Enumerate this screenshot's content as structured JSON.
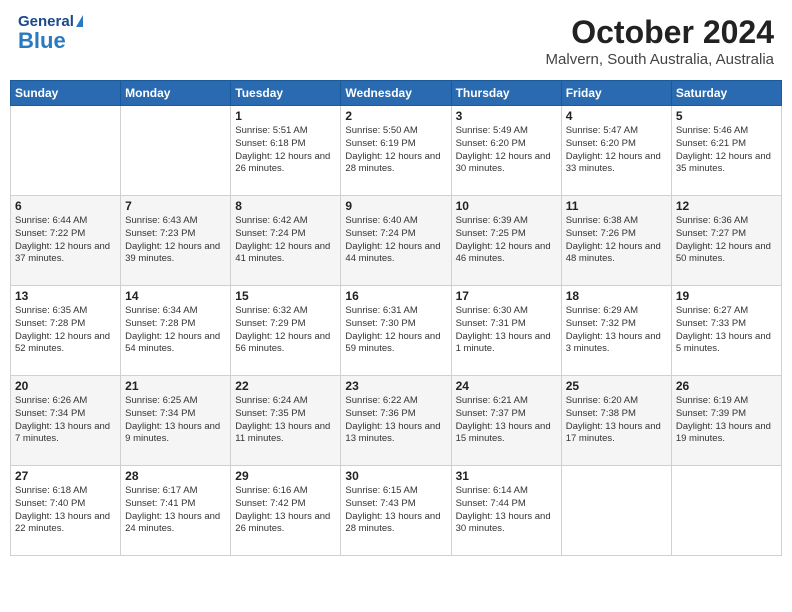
{
  "header": {
    "logo_general": "General",
    "logo_blue": "Blue",
    "title": "October 2024",
    "subtitle": "Malvern, South Australia, Australia"
  },
  "days_of_week": [
    "Sunday",
    "Monday",
    "Tuesday",
    "Wednesday",
    "Thursday",
    "Friday",
    "Saturday"
  ],
  "weeks": [
    [
      {
        "day": "",
        "sunrise": "",
        "sunset": "",
        "daylight": ""
      },
      {
        "day": "",
        "sunrise": "",
        "sunset": "",
        "daylight": ""
      },
      {
        "day": "1",
        "sunrise": "Sunrise: 5:51 AM",
        "sunset": "Sunset: 6:18 PM",
        "daylight": "Daylight: 12 hours and 26 minutes."
      },
      {
        "day": "2",
        "sunrise": "Sunrise: 5:50 AM",
        "sunset": "Sunset: 6:19 PM",
        "daylight": "Daylight: 12 hours and 28 minutes."
      },
      {
        "day": "3",
        "sunrise": "Sunrise: 5:49 AM",
        "sunset": "Sunset: 6:20 PM",
        "daylight": "Daylight: 12 hours and 30 minutes."
      },
      {
        "day": "4",
        "sunrise": "Sunrise: 5:47 AM",
        "sunset": "Sunset: 6:20 PM",
        "daylight": "Daylight: 12 hours and 33 minutes."
      },
      {
        "day": "5",
        "sunrise": "Sunrise: 5:46 AM",
        "sunset": "Sunset: 6:21 PM",
        "daylight": "Daylight: 12 hours and 35 minutes."
      }
    ],
    [
      {
        "day": "6",
        "sunrise": "Sunrise: 6:44 AM",
        "sunset": "Sunset: 7:22 PM",
        "daylight": "Daylight: 12 hours and 37 minutes."
      },
      {
        "day": "7",
        "sunrise": "Sunrise: 6:43 AM",
        "sunset": "Sunset: 7:23 PM",
        "daylight": "Daylight: 12 hours and 39 minutes."
      },
      {
        "day": "8",
        "sunrise": "Sunrise: 6:42 AM",
        "sunset": "Sunset: 7:24 PM",
        "daylight": "Daylight: 12 hours and 41 minutes."
      },
      {
        "day": "9",
        "sunrise": "Sunrise: 6:40 AM",
        "sunset": "Sunset: 7:24 PM",
        "daylight": "Daylight: 12 hours and 44 minutes."
      },
      {
        "day": "10",
        "sunrise": "Sunrise: 6:39 AM",
        "sunset": "Sunset: 7:25 PM",
        "daylight": "Daylight: 12 hours and 46 minutes."
      },
      {
        "day": "11",
        "sunrise": "Sunrise: 6:38 AM",
        "sunset": "Sunset: 7:26 PM",
        "daylight": "Daylight: 12 hours and 48 minutes."
      },
      {
        "day": "12",
        "sunrise": "Sunrise: 6:36 AM",
        "sunset": "Sunset: 7:27 PM",
        "daylight": "Daylight: 12 hours and 50 minutes."
      }
    ],
    [
      {
        "day": "13",
        "sunrise": "Sunrise: 6:35 AM",
        "sunset": "Sunset: 7:28 PM",
        "daylight": "Daylight: 12 hours and 52 minutes."
      },
      {
        "day": "14",
        "sunrise": "Sunrise: 6:34 AM",
        "sunset": "Sunset: 7:28 PM",
        "daylight": "Daylight: 12 hours and 54 minutes."
      },
      {
        "day": "15",
        "sunrise": "Sunrise: 6:32 AM",
        "sunset": "Sunset: 7:29 PM",
        "daylight": "Daylight: 12 hours and 56 minutes."
      },
      {
        "day": "16",
        "sunrise": "Sunrise: 6:31 AM",
        "sunset": "Sunset: 7:30 PM",
        "daylight": "Daylight: 12 hours and 59 minutes."
      },
      {
        "day": "17",
        "sunrise": "Sunrise: 6:30 AM",
        "sunset": "Sunset: 7:31 PM",
        "daylight": "Daylight: 13 hours and 1 minute."
      },
      {
        "day": "18",
        "sunrise": "Sunrise: 6:29 AM",
        "sunset": "Sunset: 7:32 PM",
        "daylight": "Daylight: 13 hours and 3 minutes."
      },
      {
        "day": "19",
        "sunrise": "Sunrise: 6:27 AM",
        "sunset": "Sunset: 7:33 PM",
        "daylight": "Daylight: 13 hours and 5 minutes."
      }
    ],
    [
      {
        "day": "20",
        "sunrise": "Sunrise: 6:26 AM",
        "sunset": "Sunset: 7:34 PM",
        "daylight": "Daylight: 13 hours and 7 minutes."
      },
      {
        "day": "21",
        "sunrise": "Sunrise: 6:25 AM",
        "sunset": "Sunset: 7:34 PM",
        "daylight": "Daylight: 13 hours and 9 minutes."
      },
      {
        "day": "22",
        "sunrise": "Sunrise: 6:24 AM",
        "sunset": "Sunset: 7:35 PM",
        "daylight": "Daylight: 13 hours and 11 minutes."
      },
      {
        "day": "23",
        "sunrise": "Sunrise: 6:22 AM",
        "sunset": "Sunset: 7:36 PM",
        "daylight": "Daylight: 13 hours and 13 minutes."
      },
      {
        "day": "24",
        "sunrise": "Sunrise: 6:21 AM",
        "sunset": "Sunset: 7:37 PM",
        "daylight": "Daylight: 13 hours and 15 minutes."
      },
      {
        "day": "25",
        "sunrise": "Sunrise: 6:20 AM",
        "sunset": "Sunset: 7:38 PM",
        "daylight": "Daylight: 13 hours and 17 minutes."
      },
      {
        "day": "26",
        "sunrise": "Sunrise: 6:19 AM",
        "sunset": "Sunset: 7:39 PM",
        "daylight": "Daylight: 13 hours and 19 minutes."
      }
    ],
    [
      {
        "day": "27",
        "sunrise": "Sunrise: 6:18 AM",
        "sunset": "Sunset: 7:40 PM",
        "daylight": "Daylight: 13 hours and 22 minutes."
      },
      {
        "day": "28",
        "sunrise": "Sunrise: 6:17 AM",
        "sunset": "Sunset: 7:41 PM",
        "daylight": "Daylight: 13 hours and 24 minutes."
      },
      {
        "day": "29",
        "sunrise": "Sunrise: 6:16 AM",
        "sunset": "Sunset: 7:42 PM",
        "daylight": "Daylight: 13 hours and 26 minutes."
      },
      {
        "day": "30",
        "sunrise": "Sunrise: 6:15 AM",
        "sunset": "Sunset: 7:43 PM",
        "daylight": "Daylight: 13 hours and 28 minutes."
      },
      {
        "day": "31",
        "sunrise": "Sunrise: 6:14 AM",
        "sunset": "Sunset: 7:44 PM",
        "daylight": "Daylight: 13 hours and 30 minutes."
      },
      {
        "day": "",
        "sunrise": "",
        "sunset": "",
        "daylight": ""
      },
      {
        "day": "",
        "sunrise": "",
        "sunset": "",
        "daylight": ""
      }
    ]
  ]
}
